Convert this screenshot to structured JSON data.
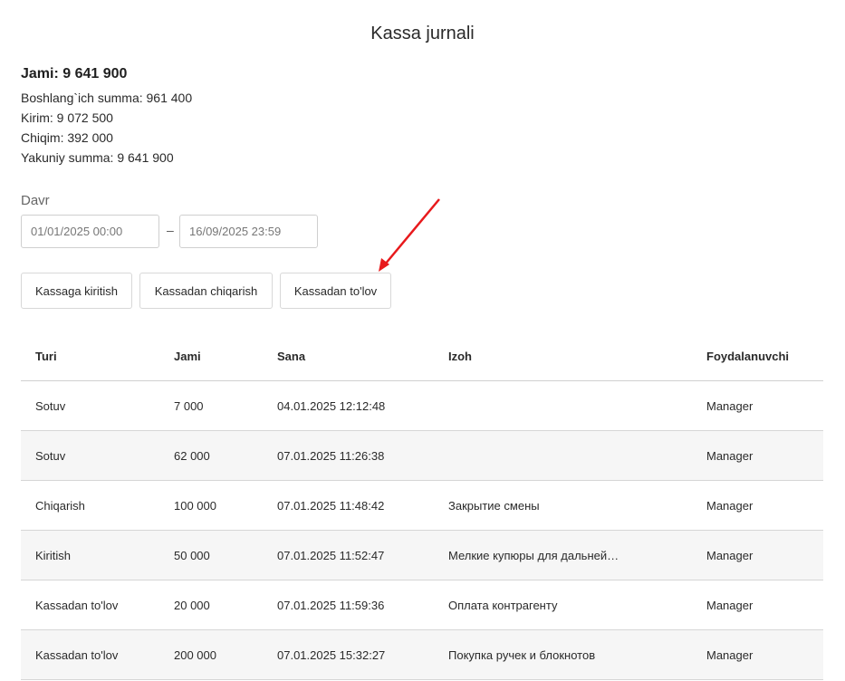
{
  "page": {
    "title": "Kassa jurnali"
  },
  "summary": {
    "total": "Jami: 9 641 900",
    "opening": "Boshlang`ich summa: 961 400",
    "income": "Kirim: 9 072 500",
    "expense": "Chiqim: 392 000",
    "closing": "Yakuniy summa: 9 641 900"
  },
  "period": {
    "label": "Davr",
    "from": "01/01/2025 00:00",
    "separator": "–",
    "to": "16/09/2025 23:59"
  },
  "actions": {
    "cash_in": "Kassaga kiritish",
    "cash_out": "Kassadan chiqarish",
    "cash_payment": "Kassadan to'lov"
  },
  "colors": {
    "annotation_arrow": "#e8191c"
  },
  "table": {
    "headers": [
      "Turi",
      "Jami",
      "Sana",
      "Izoh",
      "Foydalanuvchi"
    ],
    "rows": [
      [
        "Sotuv",
        "7 000",
        "04.01.2025 12:12:48",
        "",
        "Manager"
      ],
      [
        "Sotuv",
        "62 000",
        "07.01.2025 11:26:38",
        "",
        "Manager"
      ],
      [
        "Chiqarish",
        "100 000",
        "07.01.2025 11:48:42",
        "Закрытие смены",
        "Manager"
      ],
      [
        "Kiritish",
        "50 000",
        "07.01.2025 11:52:47",
        "Мелкие купюры для дальней…",
        "Manager"
      ],
      [
        "Kassadan to'lov",
        "20 000",
        "07.01.2025 11:59:36",
        "Оплата контрагенту",
        "Manager"
      ],
      [
        "Kassadan to'lov",
        "200 000",
        "07.01.2025 15:32:27",
        "Покупка ручек и блокнотов",
        "Manager"
      ]
    ]
  }
}
